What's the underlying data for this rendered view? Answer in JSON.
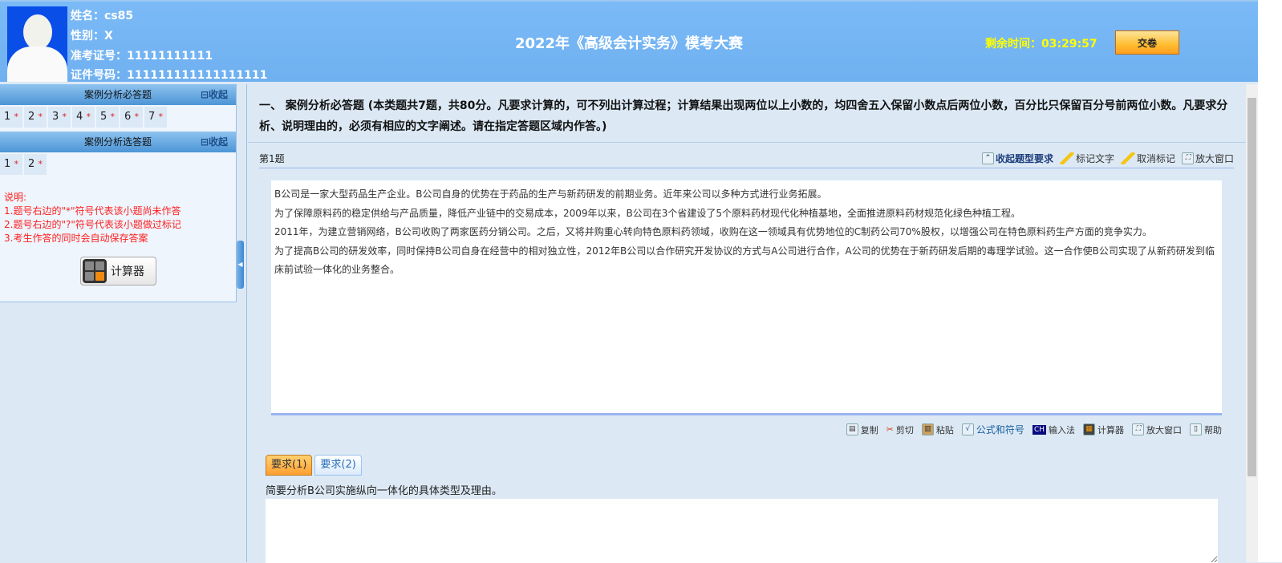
{
  "header": {
    "name": "姓名：cs85",
    "gender": "性别：X",
    "exam_no": "准考证号：11111111111",
    "id_no": "证件号码：111111111111111111",
    "title": "2022年《高级会计实务》模考大赛",
    "timer": "剩余时间：03:29:57",
    "submit": "交卷"
  },
  "left": {
    "sec1": {
      "title": "案例分析必答题",
      "collapse": "⊟收起",
      "items": [
        "1",
        "2",
        "3",
        "4",
        "5",
        "6",
        "7"
      ]
    },
    "sec2": {
      "title": "案例分析选答题",
      "collapse": "⊟收起",
      "items": [
        "1",
        "2"
      ]
    },
    "star": "*",
    "notes": [
      "说明:",
      "1.题号右边的\"*\"符号代表该小题尚未作答",
      "2.题号右边的\"?\"符号代表该小题做过标记",
      "3.考生作答的同时会自动保存答案"
    ],
    "calculator": "计算器"
  },
  "main": {
    "section_title": "一、 案例分析必答题 (本类题共7题，共80分。凡要求计算的，可不列出计算过程；计算结果出现两位以上小数的，均四舍五入保留小数点后两位小数，百分比只保留百分号前两位小数。凡要求分析、说明理由的，必须有相应的文字阐述。请在指定答题区域内作答。)",
    "question_label": "第1题",
    "qtools": [
      "收起题型要求",
      "标记文字",
      "取消标记",
      "放大窗口"
    ],
    "paragraphs": [
      "B公司是一家大型药品生产企业。B公司自身的优势在于药品的生产与新药研发的前期业务。近年来公司以多种方式进行业务拓展。",
      "为了保障原料药的稳定供给与产品质量，降低产业链中的交易成本，2009年以来，B公司在3个省建设了5个原料药材现代化种植基地，全面推进原料药材规范化绿色种植工程。",
      "2011年，为建立营销网络，B公司收购了两家医药分销公司。之后，又将并购重心转向特色原料药领域，收购在这一领域具有优势地位的C制药公司70%股权，以增强公司在特色原料药生产方面的竞争实力。",
      "为了提高B公司的研发效率，同时保持B公司自身在经营中的相对独立性，2012年B公司以合作研究开发协议的方式与A公司进行合作，A公司的优势在于新药研发后期的毒理学试验。这一合作使B公司实现了从新药研发到临床前试验一体化的业务整合。"
    ],
    "edtools": {
      "copy": "复制",
      "cut": "剪切",
      "paste": "粘贴",
      "formula": "公式和符号",
      "ime_icon": "CH",
      "ime": "输入法",
      "calc": "计算器",
      "maximize": "放大窗口",
      "help": "帮助"
    },
    "tabs": [
      "要求(1)",
      "要求(2)"
    ],
    "prompt": "简要分析B公司实施纵向一体化的具体类型及理由。",
    "answer": ""
  }
}
